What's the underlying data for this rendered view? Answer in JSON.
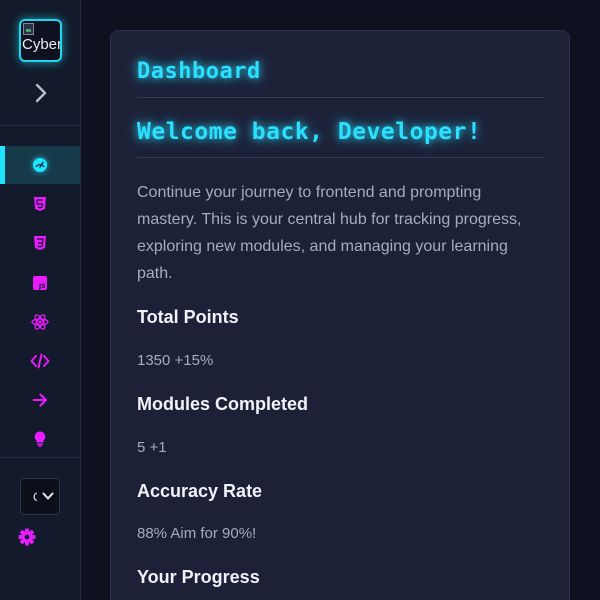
{
  "sidebar": {
    "logo_alt": "Cyber",
    "expand_icon": "chevron-right-icon",
    "nav": [
      {
        "icon": "dashboard-icon",
        "active": true
      },
      {
        "icon": "html5-icon",
        "active": false
      },
      {
        "icon": "css3-icon",
        "active": false
      },
      {
        "icon": "javascript-icon",
        "active": false
      },
      {
        "icon": "react-icon",
        "active": false
      },
      {
        "icon": "code-icon",
        "active": false
      },
      {
        "icon": "arrow-right-icon",
        "active": false
      },
      {
        "icon": "lightbulb-icon",
        "active": false
      }
    ],
    "select_value": "C",
    "settings_icon": "gear-icon"
  },
  "main": {
    "page_title": "Dashboard",
    "welcome": "Welcome back, Developer!",
    "intro": "Continue your journey to frontend and prompting mastery. This is your central hub for tracking progress, exploring new modules, and managing your learning path.",
    "stats": [
      {
        "label": "Total Points",
        "value": "1350 +15%"
      },
      {
        "label": "Modules Completed",
        "value": "5 +1"
      },
      {
        "label": "Accuracy Rate",
        "value": "88% Aim for 90%!"
      }
    ],
    "progress_heading": "Your Progress"
  },
  "colors": {
    "accent_cyan": "#2be0ff",
    "accent_magenta": "#e81cff",
    "panel_bg": "#1d2138",
    "sidebar_bg": "#121a2b"
  }
}
